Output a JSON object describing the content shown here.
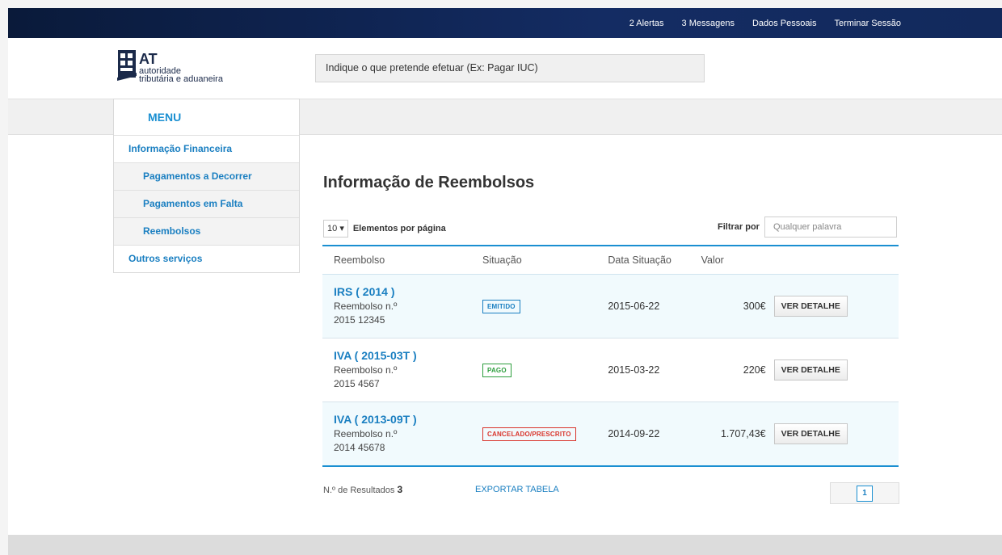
{
  "topnav": {
    "alerts": "2 Alertas",
    "messages": "3 Messagens",
    "personal": "Dados Pessoais",
    "logout": "Terminar Sessão"
  },
  "logo": {
    "abbr": "AT",
    "line1": "autoridade",
    "line2": "tributária e aduaneira"
  },
  "search": {
    "placeholder": "Indique o que pretende efetuar (Ex: Pagar IUC)"
  },
  "sidebar": {
    "title": "MENU",
    "items": [
      {
        "label": "Informação Financeira",
        "level": 1
      },
      {
        "label": "Pagamentos a Decorrer",
        "level": 2
      },
      {
        "label": "Pagamentos em Falta",
        "level": 2
      },
      {
        "label": "Reembolsos",
        "level": 2
      },
      {
        "label": "Outros serviços",
        "level": 1
      }
    ]
  },
  "main": {
    "title": "Informação de Reembolsos",
    "per_page_value": "10",
    "per_page_label": "Elementos por página",
    "filter_label": "Filtrar por",
    "filter_placeholder": "Qualquer palavra",
    "columns": [
      "Reembolso",
      "Situação",
      "Data Situação",
      "Valor"
    ],
    "rows": [
      {
        "title": "IRS ( 2014 )",
        "sub1": "Reembolso n.º",
        "sub2": "2015 12345",
        "status": "EMITIDO",
        "status_color": "#1a7fc1",
        "date": "2015-06-22",
        "value": "300€",
        "button": "VER DETALHE"
      },
      {
        "title": "IVA ( 2015-03T )",
        "sub1": "Reembolso n.º",
        "sub2": "2015 4567",
        "status": "PAGO",
        "status_color": "#2e9e3e",
        "date": "2015-03-22",
        "value": "220€",
        "button": "VER DETALHE"
      },
      {
        "title": "IVA ( 2013-09T )",
        "sub1": "Reembolso n.º",
        "sub2": "2014 45678",
        "status": "CANCELADO/PRESCRITO",
        "status_color": "#d9342b",
        "date": "2014-09-22",
        "value": "1.707,43€",
        "button": "VER DETALHE"
      }
    ],
    "results_label": "N.º de Resultados",
    "results_count": "3",
    "export_label": "EXPORTAR TABELA",
    "current_page": "1"
  },
  "colors": {
    "topbar": "#0f2452",
    "accent": "#1a8fd1",
    "link": "#1a7fc1"
  }
}
